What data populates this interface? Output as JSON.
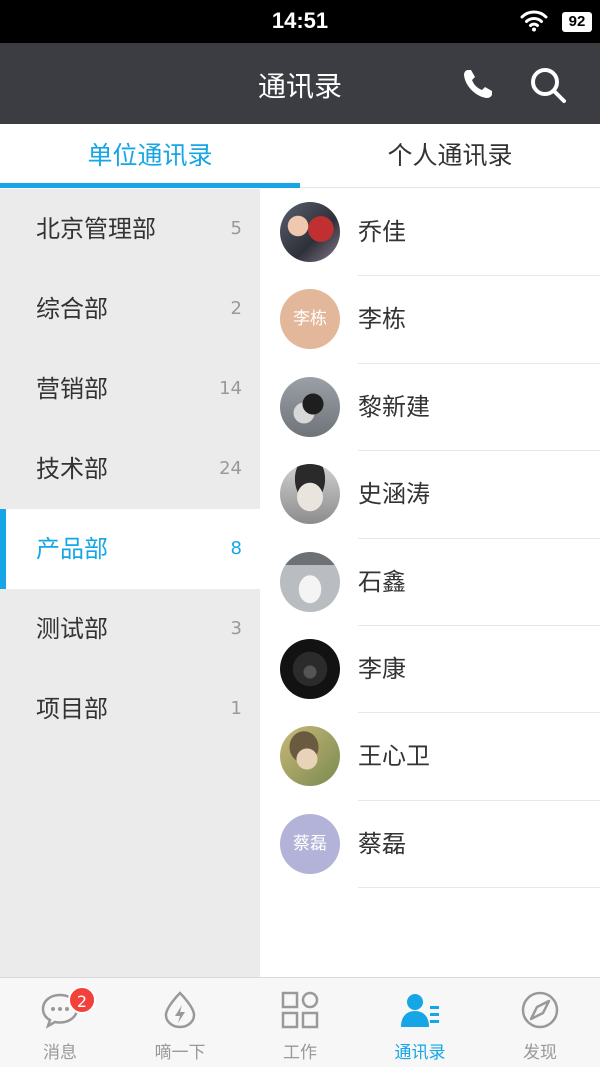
{
  "status_bar": {
    "time": "14:51",
    "battery": "92"
  },
  "nav": {
    "title": "通讯录",
    "phone_icon": "phone-icon",
    "search_icon": "search-icon"
  },
  "tabs": [
    {
      "label": "单位通讯录",
      "active": true
    },
    {
      "label": "个人通讯录",
      "active": false
    }
  ],
  "departments": [
    {
      "name": "北京管理部",
      "count": "5"
    },
    {
      "name": "综合部",
      "count": "2"
    },
    {
      "name": "营销部",
      "count": "14"
    },
    {
      "name": "技术部",
      "count": "24"
    },
    {
      "name": "产品部",
      "count": "8",
      "active": true
    },
    {
      "name": "测试部",
      "count": "3"
    },
    {
      "name": "项目部",
      "count": "1"
    }
  ],
  "contacts": [
    {
      "name": "乔佳",
      "avatar": "photo",
      "avatar_text": ""
    },
    {
      "name": "李栋",
      "avatar": "initials",
      "avatar_text": "李栋",
      "avatar_color": "#e3b799"
    },
    {
      "name": "黎新建",
      "avatar": "photo",
      "avatar_text": ""
    },
    {
      "name": "史涵涛",
      "avatar": "photo",
      "avatar_text": ""
    },
    {
      "name": "石鑫",
      "avatar": "photo",
      "avatar_text": ""
    },
    {
      "name": "李康",
      "avatar": "photo",
      "avatar_text": ""
    },
    {
      "name": "王心卫",
      "avatar": "photo",
      "avatar_text": ""
    },
    {
      "name": "蔡磊",
      "avatar": "initials",
      "avatar_text": "蔡磊",
      "avatar_color": "#b3b3d9"
    }
  ],
  "tab_bar": [
    {
      "label": "消息",
      "icon": "chat-bubble-icon",
      "badge": "2"
    },
    {
      "label": "嘀一下",
      "icon": "lightning-icon"
    },
    {
      "label": "工作",
      "icon": "grid-icon"
    },
    {
      "label": "通讯录",
      "icon": "contacts-icon",
      "active": true
    },
    {
      "label": "发现",
      "icon": "compass-icon"
    }
  ],
  "colors": {
    "accent": "#16a6e6",
    "nav_bg": "#3b3d42",
    "badge": "#f2413a"
  }
}
